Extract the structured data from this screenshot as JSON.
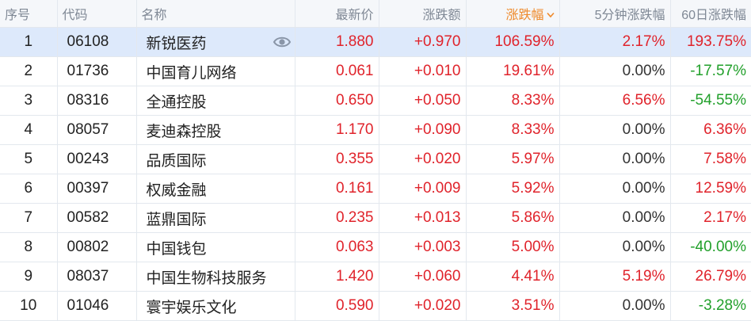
{
  "table": {
    "columns": [
      {
        "key": "idx",
        "label": "序号"
      },
      {
        "key": "code",
        "label": "代码"
      },
      {
        "key": "name",
        "label": "名称"
      },
      {
        "key": "price",
        "label": "最新价"
      },
      {
        "key": "change",
        "label": "涨跌额"
      },
      {
        "key": "pct",
        "label": "涨跌幅",
        "sorted": "desc"
      },
      {
        "key": "pct5",
        "label": "5分钟涨跌幅"
      },
      {
        "key": "pct60",
        "label": "60日涨跌幅"
      }
    ],
    "rows": [
      {
        "idx": "1",
        "code": "06108",
        "name": "新锐医药",
        "price": "1.880",
        "change": "+0.970",
        "pct": "106.59%",
        "pct5": "2.17%",
        "pct60": "193.75%",
        "selected": true
      },
      {
        "idx": "2",
        "code": "01736",
        "name": "中国育儿网络",
        "price": "0.061",
        "change": "+0.010",
        "pct": "19.61%",
        "pct5": "0.00%",
        "pct60": "-17.57%"
      },
      {
        "idx": "3",
        "code": "08316",
        "name": "全通控股",
        "price": "0.650",
        "change": "+0.050",
        "pct": "8.33%",
        "pct5": "6.56%",
        "pct60": "-54.55%"
      },
      {
        "idx": "4",
        "code": "08057",
        "name": "麦迪森控股",
        "price": "1.170",
        "change": "+0.090",
        "pct": "8.33%",
        "pct5": "0.00%",
        "pct60": "6.36%"
      },
      {
        "idx": "5",
        "code": "00243",
        "name": "品质国际",
        "price": "0.355",
        "change": "+0.020",
        "pct": "5.97%",
        "pct5": "0.00%",
        "pct60": "7.58%"
      },
      {
        "idx": "6",
        "code": "00397",
        "name": "权威金融",
        "price": "0.161",
        "change": "+0.009",
        "pct": "5.92%",
        "pct5": "0.00%",
        "pct60": "12.59%"
      },
      {
        "idx": "7",
        "code": "00582",
        "name": "蓝鼎国际",
        "price": "0.235",
        "change": "+0.013",
        "pct": "5.86%",
        "pct5": "0.00%",
        "pct60": "2.17%"
      },
      {
        "idx": "8",
        "code": "00802",
        "name": "中国钱包",
        "price": "0.063",
        "change": "+0.003",
        "pct": "5.00%",
        "pct5": "0.00%",
        "pct60": "-40.00%"
      },
      {
        "idx": "9",
        "code": "08037",
        "name": "中国生物科技服务",
        "price": "1.420",
        "change": "+0.060",
        "pct": "4.41%",
        "pct5": "5.19%",
        "pct60": "26.79%"
      },
      {
        "idx": "10",
        "code": "01046",
        "name": "寰宇娱乐文化",
        "price": "0.590",
        "change": "+0.020",
        "pct": "3.51%",
        "pct5": "0.00%",
        "pct60": "-3.28%"
      }
    ]
  },
  "colors": {
    "up": "#e0232b",
    "down": "#22a02b",
    "flat": "#333333",
    "selected_row_bg": "#dde9fb",
    "header_bg": "#f5f7fa",
    "sort_accent": "#ef8a2b"
  },
  "icons": {
    "watch": "eye-icon",
    "sort": "chevron-down-icon"
  }
}
